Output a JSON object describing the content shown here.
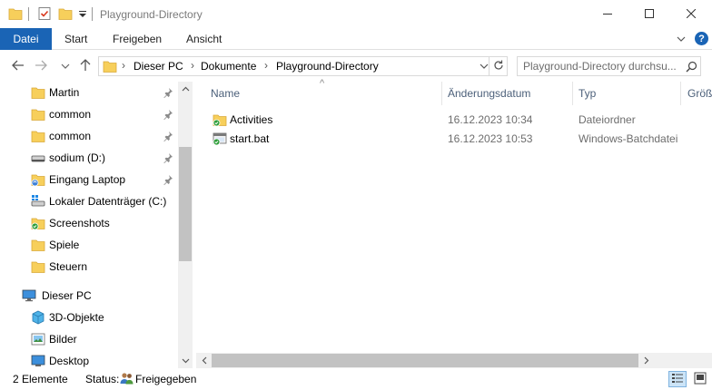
{
  "window": {
    "title": "Playground-Directory",
    "controls": {
      "minimize": "minimize-icon",
      "maximize": "maximize-icon",
      "close": "close-icon"
    }
  },
  "ribbon": {
    "tabs": [
      "Datei",
      "Start",
      "Freigeben",
      "Ansicht"
    ]
  },
  "address": {
    "crumbs": [
      "Dieser PC",
      "Dokumente",
      "Playground-Directory"
    ]
  },
  "search": {
    "placeholder": "Playground-Directory durchsu..."
  },
  "sidebar": {
    "items": [
      {
        "label": "Martin",
        "icon": "folder-icon",
        "pinned": true
      },
      {
        "label": "common",
        "icon": "folder-icon",
        "pinned": true
      },
      {
        "label": "common",
        "icon": "folder-icon",
        "pinned": true
      },
      {
        "label": "sodium (D:)",
        "icon": "drive-icon",
        "pinned": true
      },
      {
        "label": "Eingang Laptop",
        "icon": "sync-folder-icon",
        "pinned": true
      },
      {
        "label": "Lokaler Datenträger (C:)",
        "icon": "windows-drive-icon",
        "pinned": false
      },
      {
        "label": "Screenshots",
        "icon": "synced-folder-icon",
        "pinned": false
      },
      {
        "label": "Spiele",
        "icon": "folder-icon",
        "pinned": false
      },
      {
        "label": "Steuern",
        "icon": "folder-icon",
        "pinned": false
      },
      {
        "label": "Dieser PC",
        "icon": "computer-icon",
        "pinned": false
      },
      {
        "label": "3D-Objekte",
        "icon": "3d-objects-icon",
        "pinned": false
      },
      {
        "label": "Bilder",
        "icon": "pictures-icon",
        "pinned": false
      },
      {
        "label": "Desktop",
        "icon": "desktop-icon",
        "pinned": false
      }
    ]
  },
  "filelist": {
    "columns": [
      "Name",
      "Änderungsdatum",
      "Typ",
      "Größe"
    ],
    "rows": [
      {
        "name": "Activities",
        "date": "16.12.2023 10:34",
        "type": "Dateiordner",
        "icon": "synced-folder-icon"
      },
      {
        "name": "start.bat",
        "date": "16.12.2023 10:53",
        "type": "Windows-Batchdatei",
        "icon": "batch-file-icon"
      }
    ]
  },
  "status": {
    "count": "2 Elemente",
    "label": "Status:",
    "value": "Freigegeben"
  },
  "colors": {
    "accent": "#1a64b5",
    "folder": "#f7cf5b",
    "sync_green": "#2f9e3a"
  }
}
